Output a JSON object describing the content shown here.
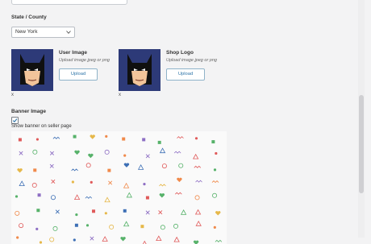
{
  "location": {
    "state_label": "State / County",
    "state_value": "New York"
  },
  "user_image": {
    "title": "User Image",
    "hint": "Upload image jpeg or png",
    "upload_label": "Upload",
    "remove_label": "x"
  },
  "shop_logo": {
    "title": "Shop Logo",
    "hint": "Upload image jpeg or png",
    "upload_label": "Upload",
    "remove_label": "x"
  },
  "banner": {
    "title": "Banner Image",
    "show_banner_label": "Show banner on seller page",
    "show_banner_checked": true
  },
  "icons": {
    "avatar": "batman-mask-icon",
    "checkbox": "check-icon",
    "select": "chevron-down-icon"
  },
  "colors": {
    "avatar_bg": "#2d3a78",
    "button_text": "#2d74a8",
    "pattern_colors": [
      "#e05a5a",
      "#3d6fb5",
      "#57b26a",
      "#e6b84a",
      "#8e6fc4",
      "#f08a4b"
    ]
  }
}
